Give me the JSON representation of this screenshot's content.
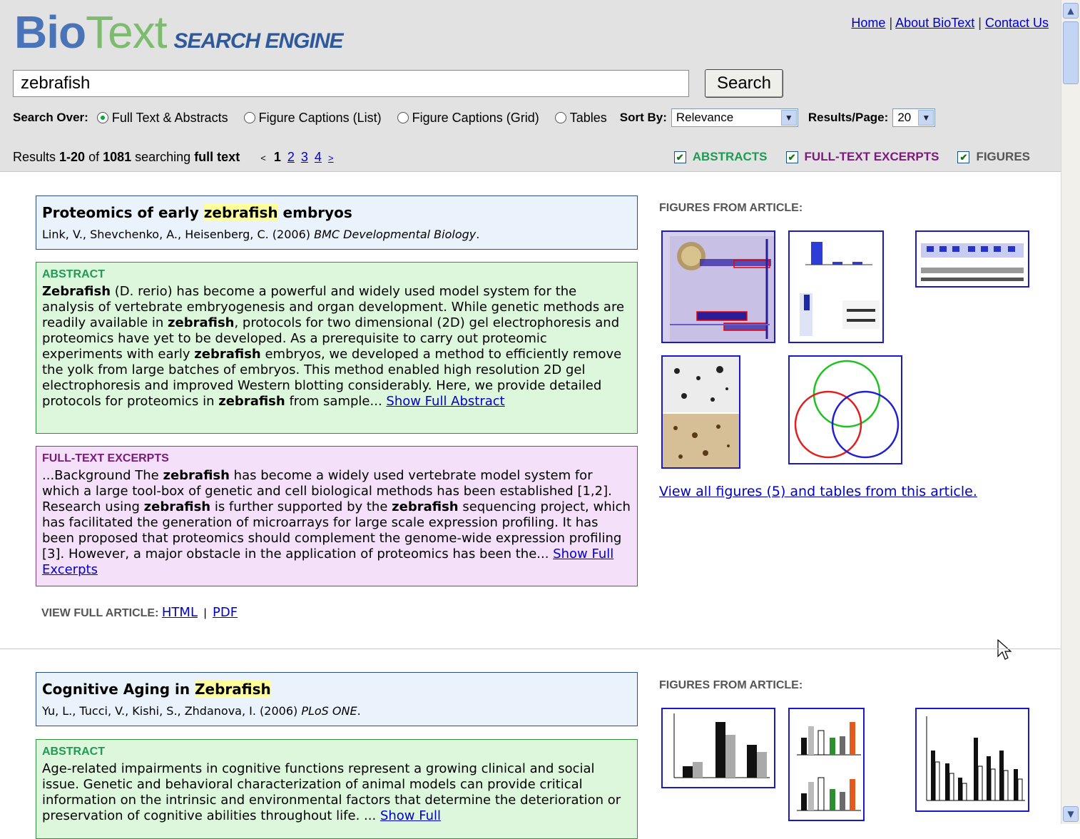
{
  "header": {
    "logo_bio": "Bio",
    "logo_text": "Text",
    "logo_sub": "SEARCH ENGINE",
    "links": [
      "Home",
      "About BioText",
      "Contact Us"
    ],
    "link_separator": "|"
  },
  "search": {
    "query": "zebrafish",
    "button_label": "Search",
    "search_over_label": "Search Over:",
    "options": [
      "Full Text & Abstracts",
      "Figure Captions (List)",
      "Figure Captions (Grid)",
      "Tables"
    ],
    "selected_option": "Full Text & Abstracts",
    "sort_label": "Sort By:",
    "sort_value": "Relevance",
    "per_page_label": "Results/Page:",
    "per_page_value": "20"
  },
  "results_bar": {
    "prefix": "Results ",
    "range": "1-20",
    "of": " of ",
    "total": "1081",
    "searching": " searching ",
    "scope": "full text",
    "prev": "<",
    "current_page": "1",
    "pages": [
      "2",
      "3",
      "4"
    ],
    "next": ">"
  },
  "toggles": [
    {
      "label": "ABSTRACTS",
      "checked": true,
      "color": "#1f9a55"
    },
    {
      "label": "FULL-TEXT EXCERPTS",
      "checked": true,
      "color": "#7a1a7a"
    },
    {
      "label": "FIGURES",
      "checked": true,
      "color": "#555555"
    }
  ],
  "results": [
    {
      "title_pre": "Proteomics of early ",
      "title_hl": "zebrafish",
      "title_post": " embryos",
      "citation_authors": "Link, V., Shevchenko, A., Heisenberg, C. (2006) ",
      "citation_journal": "BMC Developmental Biology",
      "citation_end": ".",
      "abstract_label": "ABSTRACT",
      "abstract_text": "<b>Zebrafish</b> (D. rerio) has become a powerful and widely used model system for the analysis of vertebrate embryogenesis and organ development. While genetic methods are readily available in <b>zebrafish</b>, protocols for two dimensional (2D) gel electrophoresis and proteomics have yet to be developed. As a prerequisite to carry out proteomic experiments with early <b>zebrafish</b> embryos, we developed a method to efficiently remove the yolk from large batches of embryos. This method enabled high resolution 2D gel electrophoresis and improved Western blotting considerably. Here, we provide detailed protocols for proteomics in <b>zebrafish</b> from sample... ",
      "abstract_more": "Show Full Abstract",
      "excerpt_label": "FULL-TEXT EXCERPTS",
      "excerpt_text": "...Background The <b>zebrafish</b> has become a widely used vertebrate model system for which a large tool-box of genetic and cell biological methods has been established [1,2]. Research using <b>zebrafish</b> is further supported by the <b>zebrafish</b> sequencing project, which has facilitated the generation of microarrays for large scale expression profiling. It has been proposed that proteomics should complement the genome-wide expression profiling [3]. However, a major obstacle in the application of proteomics has been the... ",
      "excerpt_more": "Show Full Excerpts",
      "view_full_label": "VIEW FULL ARTICLE:",
      "view_html": "HTML",
      "view_sep": "|",
      "view_pdf": "PDF",
      "figures_label": "FIGURES FROM ARTICLE:",
      "view_all": "View all figures (5) and tables from this article."
    },
    {
      "title_pre": "Cognitive Aging in ",
      "title_hl": "Zebrafish",
      "title_post": "",
      "citation_authors": "Yu, L., Tucci, V., Kishi, S., Zhdanova, I. (2006) ",
      "citation_journal": "PLoS ONE",
      "citation_end": ".",
      "abstract_label": "ABSTRACT",
      "abstract_text": "Age-related impairments in cognitive functions represent a growing clinical and social issue. Genetic and behavioral characterization of animal models can provide critical information on the intrinsic and environmental factors that determine the deterioration or preservation of cognitive abilities throughout life. ... ",
      "abstract_more": "Show Full",
      "figures_label": "FIGURES FROM ARTICLE:"
    }
  ]
}
